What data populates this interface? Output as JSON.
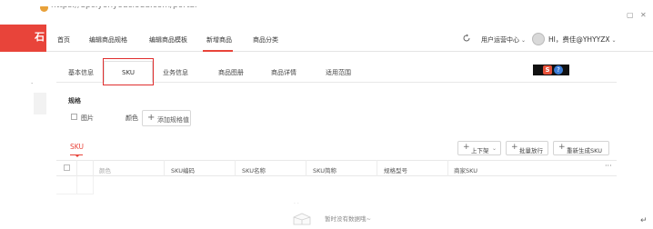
{
  "browser": {
    "url": "https://upc.yonyoucloud.com/portal"
  },
  "topnav": {
    "items": [
      "首页",
      "编辑商品规格",
      "编辑商品模板",
      "新增商品",
      "商品分类"
    ],
    "active_index": 3,
    "ops_center": "用户运营中心",
    "user": "HI，费佳@YHYYZX"
  },
  "tabs": {
    "items": [
      "基本信息",
      "SKU",
      "业务信息",
      "商品图册",
      "商品详情",
      "适用范围"
    ],
    "active": "SKU"
  },
  "spec": {
    "title": "规格",
    "image_label": "图片",
    "color_label": "颜色",
    "add_button": "添加规格值"
  },
  "sku": {
    "title": "SKU",
    "buttons": {
      "shelf": "上下架",
      "batch_release": "批量放行",
      "regenerate": "重新生成SKU"
    },
    "columns": [
      "颜色",
      "SKU编码",
      "SKU名称",
      "SKU简称",
      "规格型号",
      "商家SKU"
    ],
    "empty_text": "暂时没有数据哦~"
  },
  "colors": {
    "brand_red": "#e8443a",
    "highlight_box": "#e02e2e"
  }
}
